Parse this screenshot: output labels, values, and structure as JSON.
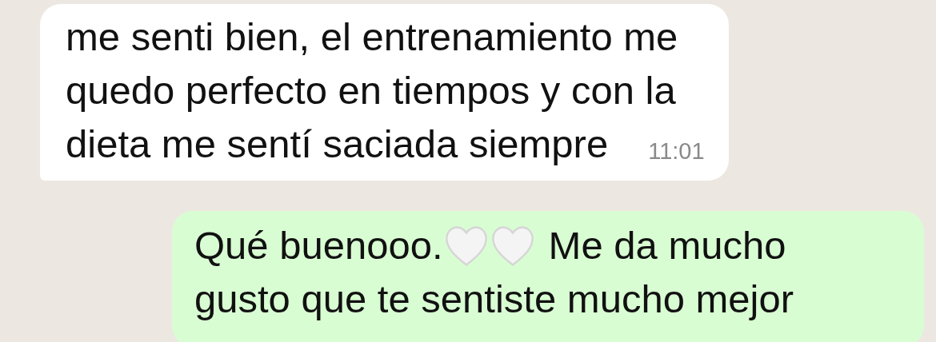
{
  "messages": [
    {
      "kind": "incoming",
      "lines": [
        [
          {
            "kind": "text",
            "text": "me senti bien, el entrenamiento me"
          }
        ],
        [
          {
            "kind": "text",
            "text": "quedo perfecto en tiempos y con la"
          }
        ],
        [
          {
            "kind": "text",
            "text": "dieta me sentí saciada siempre"
          }
        ]
      ],
      "time": "11:01"
    },
    {
      "kind": "outgoing",
      "lines": [
        [
          {
            "kind": "text",
            "text": "Qué buenooo."
          },
          {
            "kind": "heart"
          },
          {
            "kind": "heart"
          },
          {
            "kind": "text",
            "text": "Me da mucho"
          }
        ],
        [
          {
            "kind": "text",
            "text": "gusto que te sentiste mucho mejor"
          }
        ]
      ]
    }
  ]
}
